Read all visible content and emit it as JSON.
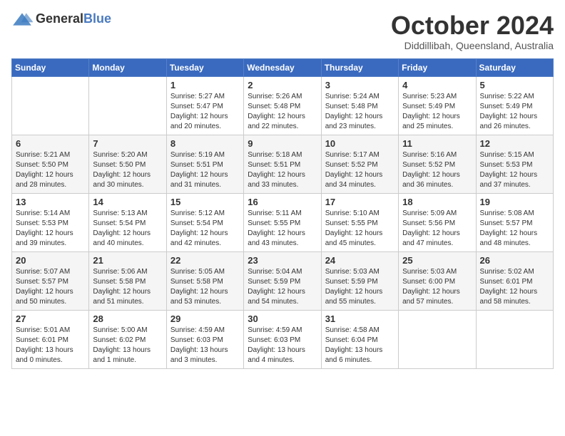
{
  "logo": {
    "general": "General",
    "blue": "Blue"
  },
  "title": "October 2024",
  "location": "Diddillibah, Queensland, Australia",
  "headers": [
    "Sunday",
    "Monday",
    "Tuesday",
    "Wednesday",
    "Thursday",
    "Friday",
    "Saturday"
  ],
  "weeks": [
    [
      {
        "day": "",
        "info": ""
      },
      {
        "day": "",
        "info": ""
      },
      {
        "day": "1",
        "info": "Sunrise: 5:27 AM\nSunset: 5:47 PM\nDaylight: 12 hours and 20 minutes."
      },
      {
        "day": "2",
        "info": "Sunrise: 5:26 AM\nSunset: 5:48 PM\nDaylight: 12 hours and 22 minutes."
      },
      {
        "day": "3",
        "info": "Sunrise: 5:24 AM\nSunset: 5:48 PM\nDaylight: 12 hours and 23 minutes."
      },
      {
        "day": "4",
        "info": "Sunrise: 5:23 AM\nSunset: 5:49 PM\nDaylight: 12 hours and 25 minutes."
      },
      {
        "day": "5",
        "info": "Sunrise: 5:22 AM\nSunset: 5:49 PM\nDaylight: 12 hours and 26 minutes."
      }
    ],
    [
      {
        "day": "6",
        "info": "Sunrise: 5:21 AM\nSunset: 5:50 PM\nDaylight: 12 hours and 28 minutes."
      },
      {
        "day": "7",
        "info": "Sunrise: 5:20 AM\nSunset: 5:50 PM\nDaylight: 12 hours and 30 minutes."
      },
      {
        "day": "8",
        "info": "Sunrise: 5:19 AM\nSunset: 5:51 PM\nDaylight: 12 hours and 31 minutes."
      },
      {
        "day": "9",
        "info": "Sunrise: 5:18 AM\nSunset: 5:51 PM\nDaylight: 12 hours and 33 minutes."
      },
      {
        "day": "10",
        "info": "Sunrise: 5:17 AM\nSunset: 5:52 PM\nDaylight: 12 hours and 34 minutes."
      },
      {
        "day": "11",
        "info": "Sunrise: 5:16 AM\nSunset: 5:52 PM\nDaylight: 12 hours and 36 minutes."
      },
      {
        "day": "12",
        "info": "Sunrise: 5:15 AM\nSunset: 5:53 PM\nDaylight: 12 hours and 37 minutes."
      }
    ],
    [
      {
        "day": "13",
        "info": "Sunrise: 5:14 AM\nSunset: 5:53 PM\nDaylight: 12 hours and 39 minutes."
      },
      {
        "day": "14",
        "info": "Sunrise: 5:13 AM\nSunset: 5:54 PM\nDaylight: 12 hours and 40 minutes."
      },
      {
        "day": "15",
        "info": "Sunrise: 5:12 AM\nSunset: 5:54 PM\nDaylight: 12 hours and 42 minutes."
      },
      {
        "day": "16",
        "info": "Sunrise: 5:11 AM\nSunset: 5:55 PM\nDaylight: 12 hours and 43 minutes."
      },
      {
        "day": "17",
        "info": "Sunrise: 5:10 AM\nSunset: 5:55 PM\nDaylight: 12 hours and 45 minutes."
      },
      {
        "day": "18",
        "info": "Sunrise: 5:09 AM\nSunset: 5:56 PM\nDaylight: 12 hours and 47 minutes."
      },
      {
        "day": "19",
        "info": "Sunrise: 5:08 AM\nSunset: 5:57 PM\nDaylight: 12 hours and 48 minutes."
      }
    ],
    [
      {
        "day": "20",
        "info": "Sunrise: 5:07 AM\nSunset: 5:57 PM\nDaylight: 12 hours and 50 minutes."
      },
      {
        "day": "21",
        "info": "Sunrise: 5:06 AM\nSunset: 5:58 PM\nDaylight: 12 hours and 51 minutes."
      },
      {
        "day": "22",
        "info": "Sunrise: 5:05 AM\nSunset: 5:58 PM\nDaylight: 12 hours and 53 minutes."
      },
      {
        "day": "23",
        "info": "Sunrise: 5:04 AM\nSunset: 5:59 PM\nDaylight: 12 hours and 54 minutes."
      },
      {
        "day": "24",
        "info": "Sunrise: 5:03 AM\nSunset: 5:59 PM\nDaylight: 12 hours and 55 minutes."
      },
      {
        "day": "25",
        "info": "Sunrise: 5:03 AM\nSunset: 6:00 PM\nDaylight: 12 hours and 57 minutes."
      },
      {
        "day": "26",
        "info": "Sunrise: 5:02 AM\nSunset: 6:01 PM\nDaylight: 12 hours and 58 minutes."
      }
    ],
    [
      {
        "day": "27",
        "info": "Sunrise: 5:01 AM\nSunset: 6:01 PM\nDaylight: 13 hours and 0 minutes."
      },
      {
        "day": "28",
        "info": "Sunrise: 5:00 AM\nSunset: 6:02 PM\nDaylight: 13 hours and 1 minute."
      },
      {
        "day": "29",
        "info": "Sunrise: 4:59 AM\nSunset: 6:03 PM\nDaylight: 13 hours and 3 minutes."
      },
      {
        "day": "30",
        "info": "Sunrise: 4:59 AM\nSunset: 6:03 PM\nDaylight: 13 hours and 4 minutes."
      },
      {
        "day": "31",
        "info": "Sunrise: 4:58 AM\nSunset: 6:04 PM\nDaylight: 13 hours and 6 minutes."
      },
      {
        "day": "",
        "info": ""
      },
      {
        "day": "",
        "info": ""
      }
    ]
  ]
}
